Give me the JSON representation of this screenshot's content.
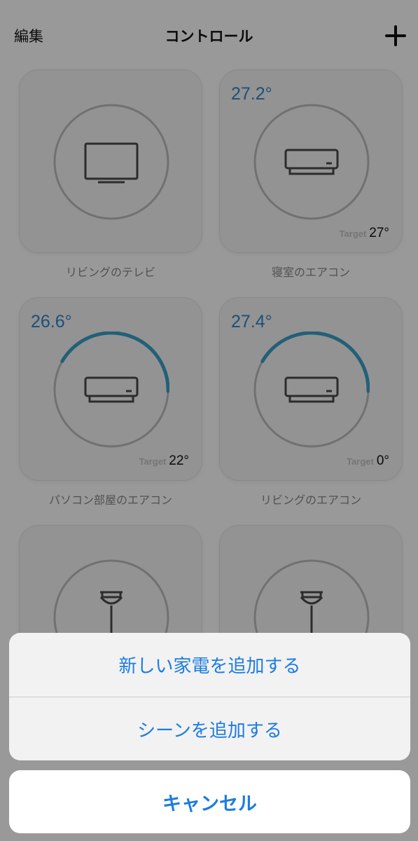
{
  "header": {
    "edit_label": "編集",
    "title": "コントロール",
    "add_icon": "plus-icon"
  },
  "devices": [
    {
      "name": "リビングのテレビ",
      "icon": "tv-icon",
      "temperature": null,
      "target_label": null,
      "target": null
    },
    {
      "name": "寝室のエアコン",
      "icon": "air-conditioner-icon",
      "temperature": "27.2°",
      "target_label": "Target",
      "target": "27°",
      "progress": 0
    },
    {
      "name": "パソコン部屋のエアコン",
      "icon": "air-conditioner-icon",
      "temperature": "26.6°",
      "target_label": "Target",
      "target": "22°",
      "progress": 0.42
    },
    {
      "name": "リビングのエアコン",
      "icon": "air-conditioner-icon",
      "temperature": "27.4°",
      "target_label": "Target",
      "target": "0°",
      "progress": 0.42
    },
    {
      "name": "",
      "icon": "ceiling-light-icon"
    },
    {
      "name": "",
      "icon": "ceiling-light-icon"
    }
  ],
  "action_sheet": {
    "add_appliance": "新しい家電を追加する",
    "add_scene": "シーンを追加する",
    "cancel": "キャンセル"
  },
  "colors": {
    "accent": "#1c7ce0",
    "ring_active": "#3aa0c8",
    "temperature": "#2f86c9"
  }
}
